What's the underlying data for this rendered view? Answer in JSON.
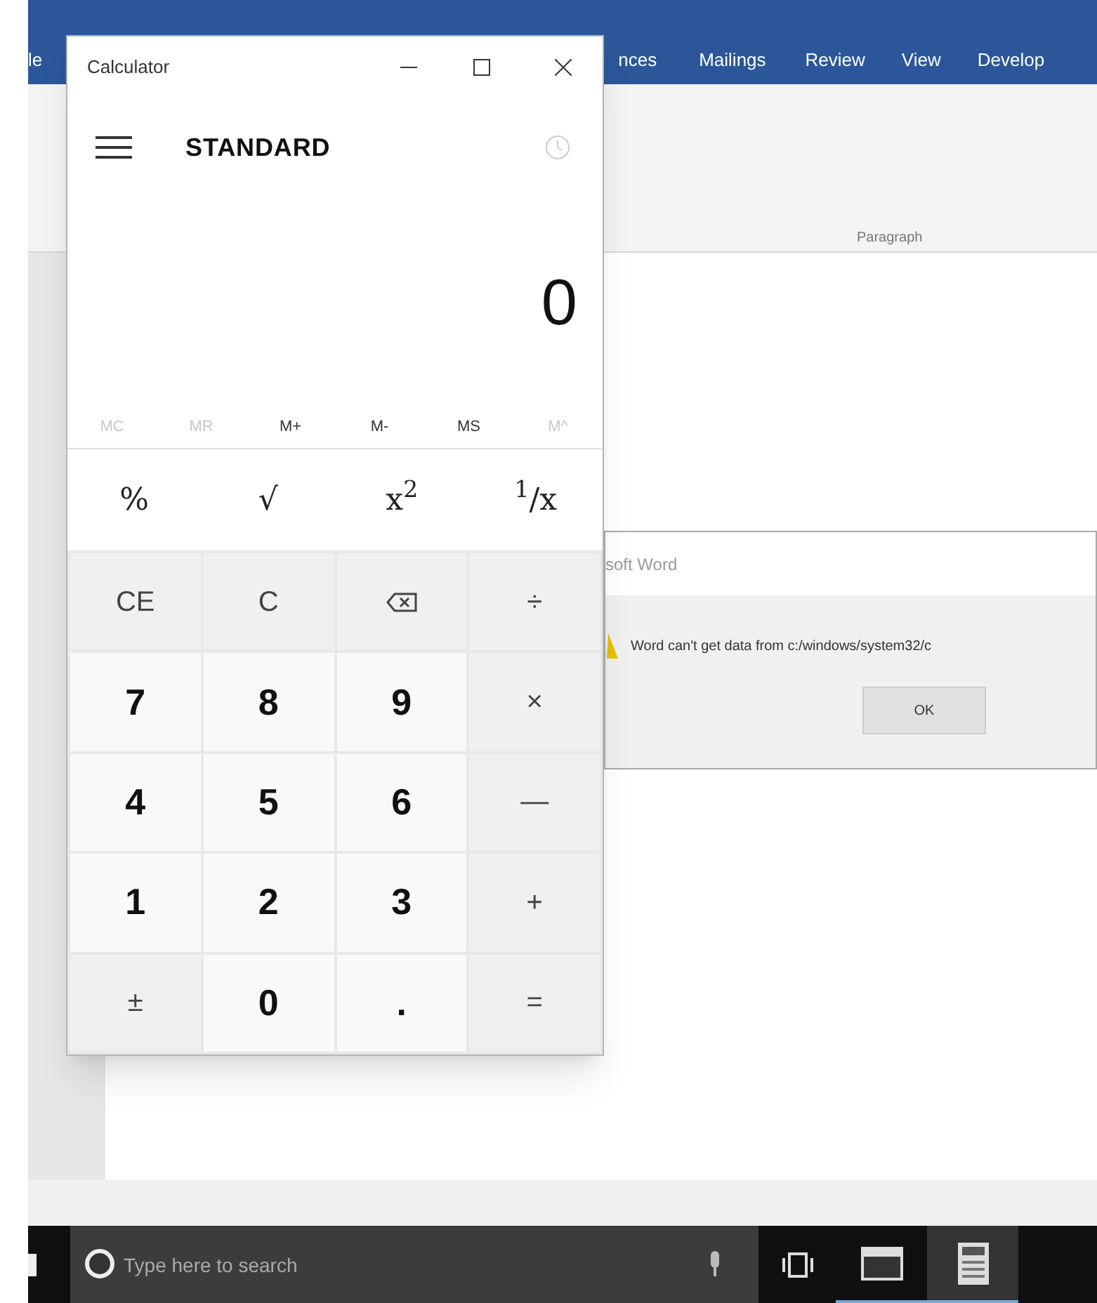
{
  "word": {
    "ribbon_tabs": [
      "le",
      "nces",
      "Mailings",
      "Review",
      "View",
      "Develop"
    ],
    "ribbon_group": "Paragraph",
    "dialog": {
      "title": "soft Word",
      "message": "Word can't get data from c:/windows/system32/c",
      "button": "OK"
    }
  },
  "calculator": {
    "title": "Calculator",
    "mode": "STANDARD",
    "display": "0",
    "memory": [
      {
        "label": "MC",
        "disabled": true
      },
      {
        "label": "MR",
        "disabled": true
      },
      {
        "label": "M+",
        "disabled": false
      },
      {
        "label": "M-",
        "disabled": false
      },
      {
        "label": "MS",
        "disabled": false
      },
      {
        "label": "M^",
        "disabled": true
      }
    ],
    "functions": [
      "%",
      "√",
      "x$^{2}$",
      "$^{1}$/x"
    ],
    "keys": [
      [
        {
          "kind": "text",
          "label": "CE"
        },
        {
          "kind": "text",
          "label": "C"
        },
        {
          "kind": "backspace"
        },
        {
          "kind": "text",
          "label": "÷"
        }
      ],
      [
        {
          "kind": "digit",
          "label": "7"
        },
        {
          "kind": "digit",
          "label": "8"
        },
        {
          "kind": "digit",
          "label": "9"
        },
        {
          "kind": "text",
          "label": "×"
        }
      ],
      [
        {
          "kind": "digit",
          "label": "4"
        },
        {
          "kind": "digit",
          "label": "5"
        },
        {
          "kind": "digit",
          "label": "6"
        },
        {
          "kind": "text",
          "label": "—"
        }
      ],
      [
        {
          "kind": "digit",
          "label": "1"
        },
        {
          "kind": "digit",
          "label": "2"
        },
        {
          "kind": "digit",
          "label": "3"
        },
        {
          "kind": "text",
          "label": "+"
        }
      ],
      [
        {
          "kind": "text",
          "label": "±"
        },
        {
          "kind": "digit",
          "label": "0"
        },
        {
          "kind": "digit",
          "label": "."
        },
        {
          "kind": "text",
          "label": "="
        }
      ]
    ]
  },
  "taskbar": {
    "search": {
      "placeholder": "Type here to search"
    }
  }
}
